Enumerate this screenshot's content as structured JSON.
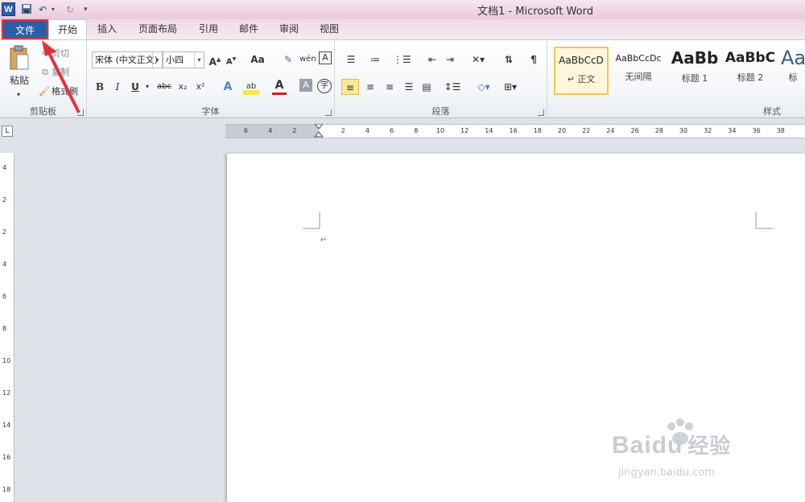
{
  "window": {
    "app_icon": "W",
    "title": "文档1 - Microsoft Word"
  },
  "tabs": [
    {
      "label": "文件",
      "kind": "file"
    },
    {
      "label": "开始",
      "kind": "active"
    },
    {
      "label": "插入"
    },
    {
      "label": "页面布局"
    },
    {
      "label": "引用"
    },
    {
      "label": "邮件"
    },
    {
      "label": "审阅"
    },
    {
      "label": "视图"
    }
  ],
  "clipboard": {
    "paste": "粘贴",
    "cut": "剪切",
    "copy": "复制",
    "format_painter": "格式刷",
    "label": "剪贴板"
  },
  "font": {
    "name": "宋体 (中文正文)",
    "size": "小四",
    "label": "字体"
  },
  "paragraph": {
    "label": "段落"
  },
  "styles": {
    "label": "样式",
    "items": [
      {
        "sample": "AaBbCcD",
        "name": "↵ 正文"
      },
      {
        "sample": "AaBbCcDc",
        "name": "无间隔"
      },
      {
        "sample": "AaBb",
        "name": "标题 1"
      },
      {
        "sample": "AaBbC",
        "name": "标题 2"
      },
      {
        "sample": "Aa",
        "name": "标"
      }
    ]
  },
  "ruler": {
    "h_ticks": [
      "6",
      "4",
      "2",
      "2",
      "4",
      "6",
      "8",
      "10",
      "12",
      "14",
      "16",
      "18",
      "20",
      "22",
      "24",
      "26",
      "28",
      "30",
      "32",
      "34",
      "36",
      "38"
    ],
    "v_ticks": [
      "4",
      "2",
      "2",
      "4",
      "6",
      "8",
      "10",
      "12",
      "14",
      "16",
      "18"
    ]
  },
  "document": {
    "paragraph_mark": "↵"
  },
  "watermark": {
    "brand": "Bai",
    "brand2": "du",
    "cn": "经验",
    "url": "jingyan.baidu.com"
  },
  "colors": {
    "file_tab": "#2c5ea8",
    "highlight_box": "#e1343a",
    "style_selected": "#f1c84b"
  }
}
